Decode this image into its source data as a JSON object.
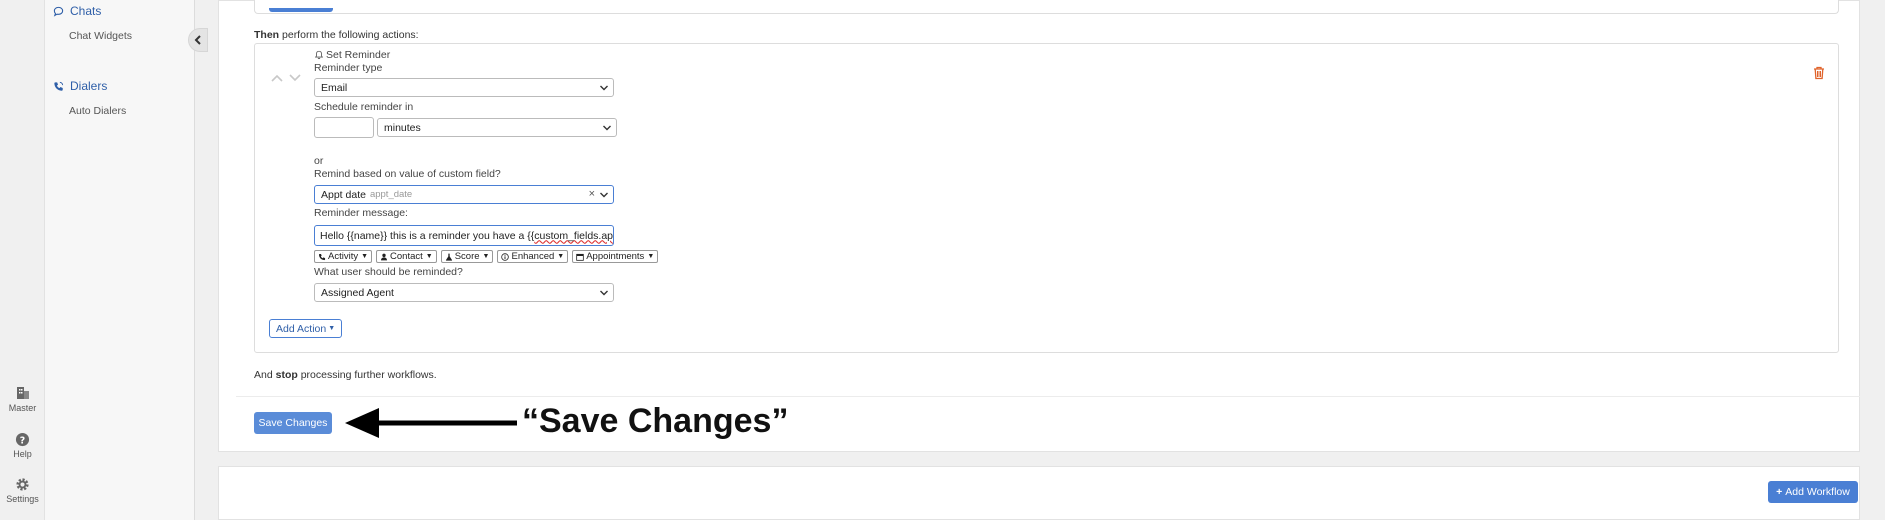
{
  "rail": {
    "master_label": "Master",
    "help_label": "Help",
    "settings_label": "Settings"
  },
  "sidebar": {
    "groups": [
      {
        "label": "Chats",
        "items": [
          {
            "label": "Chat Widgets"
          }
        ]
      },
      {
        "label": "Dialers",
        "items": [
          {
            "label": "Auto Dialers"
          }
        ]
      }
    ]
  },
  "workflow": {
    "then_prefix": "Then",
    "then_suffix": " perform the following actions:",
    "action": {
      "title": "Set Reminder",
      "reminder_type_label": "Reminder type",
      "reminder_type_value": "Email",
      "schedule_label": "Schedule reminder in",
      "schedule_amount": "",
      "schedule_unit": "minutes",
      "or_label": "or",
      "custom_field_label": "Remind based on value of custom field?",
      "custom_field_value": "Appt date",
      "custom_field_hint": "appt_date",
      "message_label": "Reminder message:",
      "message_value_prefix": "Hello {{name}} this is a reminder you have a {{",
      "message_value_squiggle": "custom_fields.ap",
      "tokens": [
        "Activity",
        "Contact",
        "Score",
        "Enhanced",
        "Appointments"
      ],
      "user_label": "What user should be reminded?",
      "user_value": "Assigned Agent"
    },
    "add_action_label": "Add Action",
    "stop_prefix": "And ",
    "stop_bold": "stop",
    "stop_suffix": " processing further workflows.",
    "save_label": "Save Changes",
    "annotation": "“Save Changes”",
    "add_workflow_label": "Add Workflow"
  },
  "colors": {
    "primary": "#4a7fd4",
    "link": "#2f5fa8",
    "danger": "#e0632b"
  }
}
